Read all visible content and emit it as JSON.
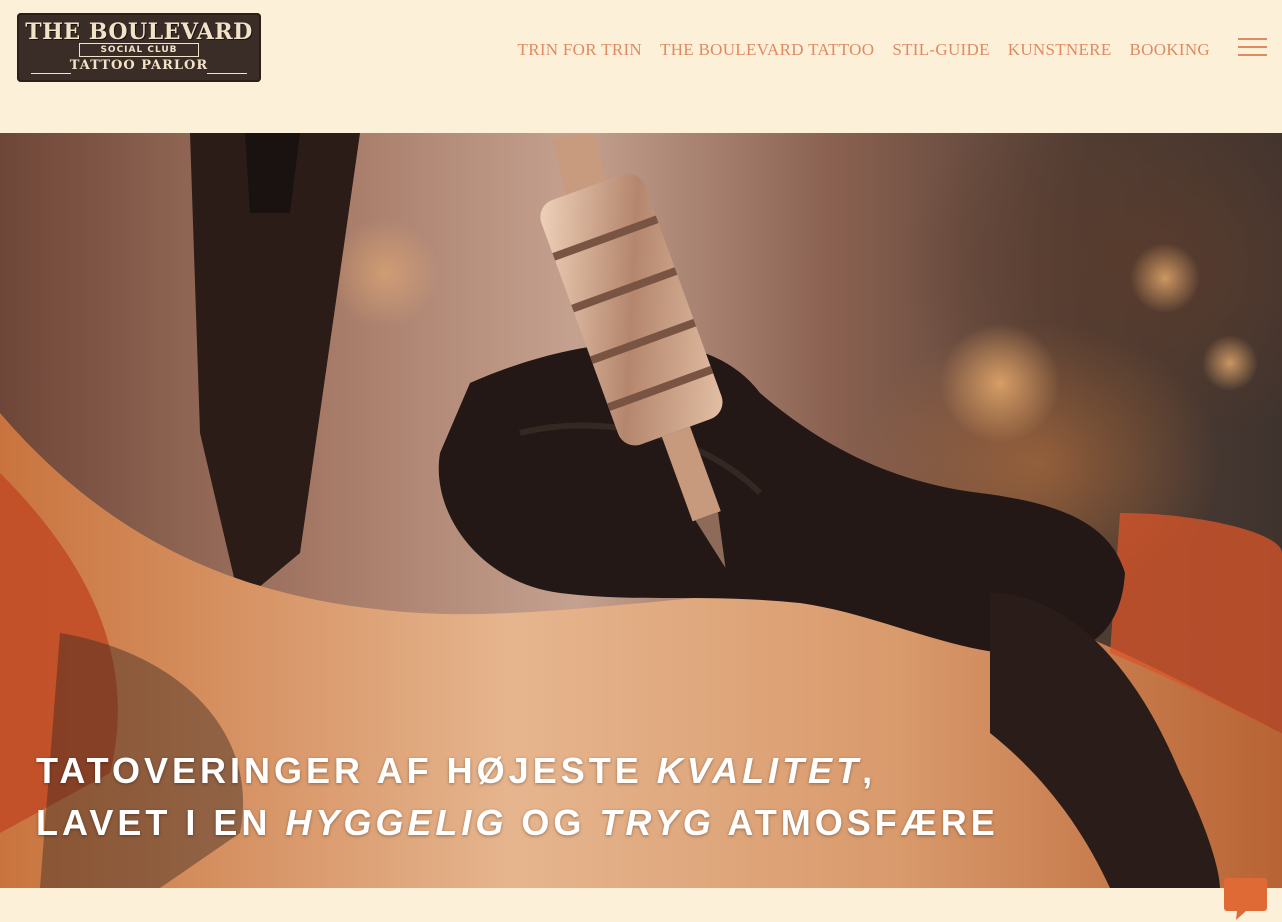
{
  "logo": {
    "line1": "THE BOULEVARD",
    "line2": "SOCIAL CLUB",
    "line3": "TATTOO PARLOR"
  },
  "nav": {
    "items": [
      {
        "label": "TRIN FOR TRIN"
      },
      {
        "label": "THE BOULEVARD TATTOO"
      },
      {
        "label": "STIL-GUIDE"
      },
      {
        "label": "KUNSTNERE"
      },
      {
        "label": "BOOKING"
      }
    ],
    "menu_icon": "hamburger-menu-icon"
  },
  "hero": {
    "line1": {
      "part1": "TATOVERINGER AF HØJESTE ",
      "emphasis1": "KVALITET",
      "part2": ","
    },
    "line2": {
      "part1": "LAVET I EN ",
      "emphasis1": "HYGGELIG",
      "part2": " OG ",
      "emphasis2": "TRYG",
      "part3": " ATMOSFÆRE"
    }
  },
  "chat": {
    "icon": "chat-bubble-icon"
  },
  "colors": {
    "background": "#fdf0d8",
    "accent": "#e08a62",
    "chat": "#e06a35",
    "logo_bg": "#3a2c26"
  }
}
